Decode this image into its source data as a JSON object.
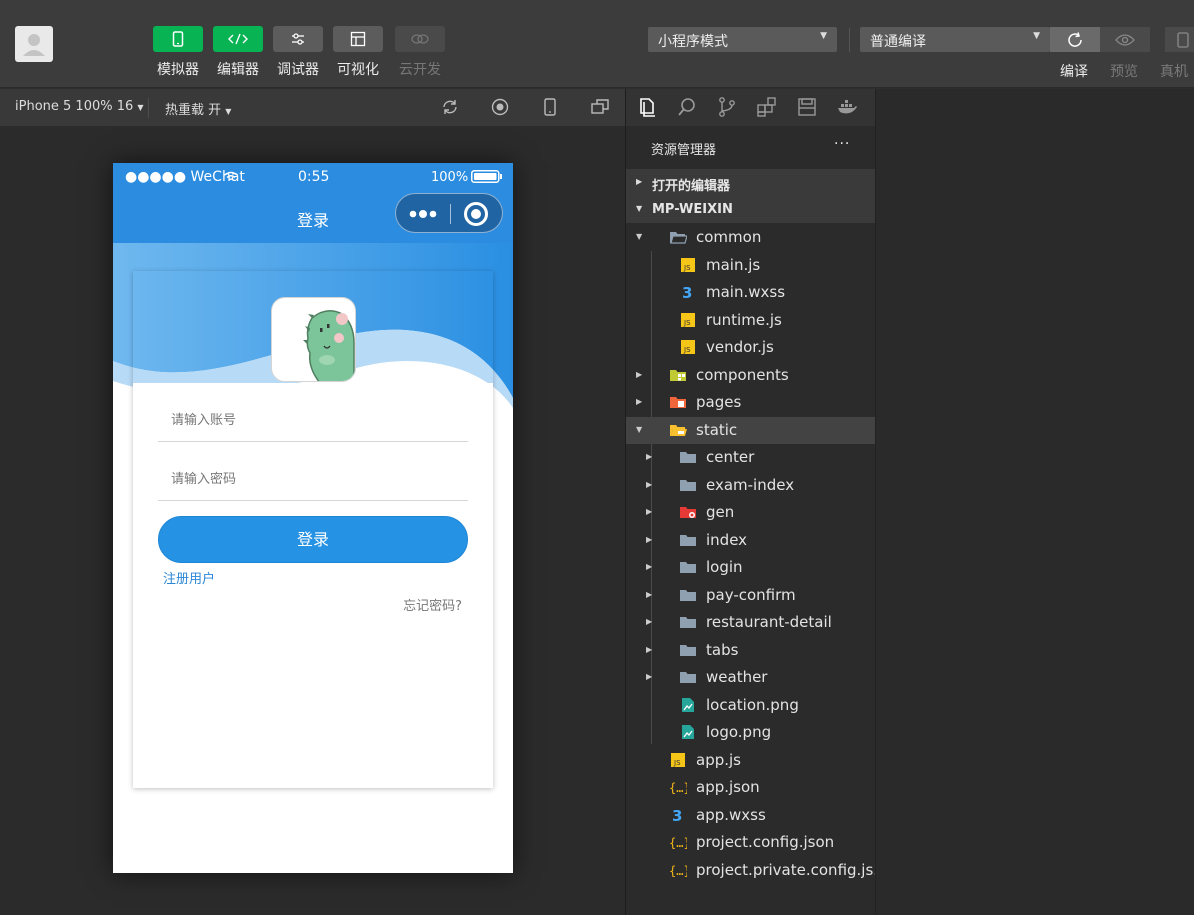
{
  "toolbar": {
    "tools": [
      {
        "label": "模拟器",
        "icon": "phone-icon"
      },
      {
        "label": "编辑器",
        "icon": "code-icon"
      },
      {
        "label": "调试器",
        "icon": "sliders-icon"
      },
      {
        "label": "可视化",
        "icon": "layout-icon"
      },
      {
        "label": "云开发",
        "icon": "cloud-icon"
      }
    ],
    "mode_select": "小程序模式",
    "compile_select": "普通编译",
    "compile_label": "编译",
    "preview_label": "预览",
    "real_device_label": "真机"
  },
  "simulator": {
    "device": "iPhone 5 100% 16",
    "hot_reload": "热重载 开"
  },
  "phone": {
    "status": {
      "carrier": "●●●●● WeChat",
      "time": "0:55",
      "battery": "100%"
    },
    "title": "登录",
    "account_placeholder": "请输入账号",
    "password_placeholder": "请输入密码",
    "login_button": "登录",
    "register_link": "注册用户",
    "forgot_link": "忘记密码?"
  },
  "explorer": {
    "title": "资源管理器",
    "more": "···",
    "open_editors": "打开的编辑器",
    "project": "MP-WEIXIN",
    "items": [
      {
        "name": "common",
        "type": "folder-open"
      },
      {
        "name": "main.js",
        "type": "js"
      },
      {
        "name": "main.wxss",
        "type": "css"
      },
      {
        "name": "runtime.js",
        "type": "js"
      },
      {
        "name": "vendor.js",
        "type": "js"
      },
      {
        "name": "components",
        "type": "folder-components"
      },
      {
        "name": "pages",
        "type": "folder-pages"
      },
      {
        "name": "static",
        "type": "folder-static"
      },
      {
        "name": "center",
        "type": "folder"
      },
      {
        "name": "exam-index",
        "type": "folder"
      },
      {
        "name": "gen",
        "type": "folder-gen"
      },
      {
        "name": "index",
        "type": "folder"
      },
      {
        "name": "login",
        "type": "folder"
      },
      {
        "name": "pay-confirm",
        "type": "folder"
      },
      {
        "name": "restaurant-detail",
        "type": "folder"
      },
      {
        "name": "tabs",
        "type": "folder"
      },
      {
        "name": "weather",
        "type": "folder"
      },
      {
        "name": "location.png",
        "type": "image"
      },
      {
        "name": "logo.png",
        "type": "image"
      },
      {
        "name": "app.js",
        "type": "js"
      },
      {
        "name": "app.json",
        "type": "json"
      },
      {
        "name": "app.wxss",
        "type": "css"
      },
      {
        "name": "project.config.json",
        "type": "json"
      },
      {
        "name": "project.private.config.js...",
        "type": "json"
      }
    ]
  }
}
